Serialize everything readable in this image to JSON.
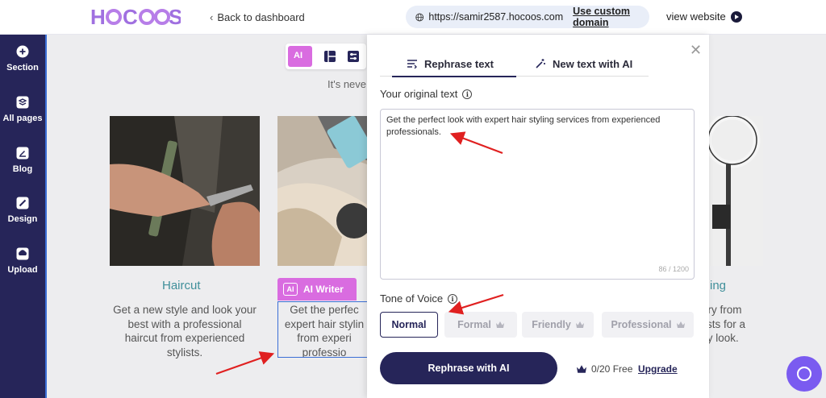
{
  "header": {
    "back_label": "Back to dashboard",
    "url": "https://samir2587.hocoos.com",
    "custom_domain_label": "Use custom domain",
    "view_website_label": "view website"
  },
  "sidebar": {
    "items": [
      {
        "label": "Section",
        "icon": "plus-circle-icon"
      },
      {
        "label": "All pages",
        "icon": "layers-icon"
      },
      {
        "label": "Blog",
        "icon": "edit-square-icon"
      },
      {
        "label": "Design",
        "icon": "brush-icon"
      },
      {
        "label": "Upload",
        "icon": "cloud-upload-icon"
      }
    ]
  },
  "canvas": {
    "toolbar_ai_label": "AI",
    "partial_text": "It's neve",
    "cards": [
      {
        "title": "Haircut",
        "description": "Get a new style and look your best with a professional haircut from experienced stylists."
      },
      {
        "title": "",
        "description": "Get the perfec expert hair stylin from experi professio"
      },
      {
        "title": "ing",
        "description": "dry from lists for a cy look."
      }
    ],
    "ai_writer_label": "AI Writer",
    "ai_badge": "AI"
  },
  "panel": {
    "tabs": [
      {
        "label": "Rephrase text",
        "active": true
      },
      {
        "label": "New text with AI",
        "active": false
      }
    ],
    "original_text_label": "Your original text",
    "original_text": "Get the perfect look with expert hair styling services from experienced professionals.",
    "char_count": "86 / 1200",
    "tone_label": "Tone of Voice",
    "tones": [
      {
        "label": "Normal",
        "active": true,
        "premium": false
      },
      {
        "label": "Formal",
        "active": false,
        "premium": true
      },
      {
        "label": "Friendly",
        "active": false,
        "premium": true
      },
      {
        "label": "Professional",
        "active": false,
        "premium": true
      }
    ],
    "rephrase_button": "Rephrase with AI",
    "free_count": "0/20 Free",
    "upgrade_label": "Upgrade"
  },
  "colors": {
    "brand": "#262559",
    "ai_accent": "#d96ce0",
    "teal_title": "#3f8f9a",
    "selection": "#3b6fd6",
    "annotation_arrow": "#e02020"
  }
}
